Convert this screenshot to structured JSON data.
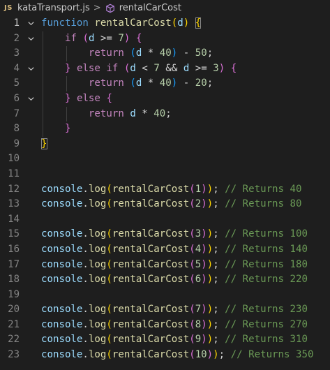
{
  "breadcrumb": {
    "file_badge": "JS",
    "file_name": "kataTransport.js",
    "separator": ">",
    "symbol_icon": "cube-method-icon",
    "symbol_name": "rentalCarCost"
  },
  "colors": {
    "background": "#1e1e1e",
    "keyword": "#569cd6",
    "control": "#c586c0",
    "function": "#dcdcaa",
    "variable": "#9cdcfe",
    "number": "#b5cea8",
    "comment": "#6a9955"
  },
  "editor": {
    "active_line": 1,
    "lines": [
      {
        "num": "1",
        "fold": true,
        "tokens": [
          {
            "t": "function",
            "c": "kw"
          },
          {
            "t": " ",
            "c": ""
          },
          {
            "t": "rentalCarCost",
            "c": "fn"
          },
          {
            "t": "(",
            "c": "br1"
          },
          {
            "t": "d",
            "c": "var"
          },
          {
            "t": ")",
            "c": "br1"
          },
          {
            "t": " ",
            "c": ""
          },
          {
            "t": "{",
            "c": "br1 bm"
          }
        ]
      },
      {
        "num": "2",
        "fold": true,
        "tokens": [
          {
            "t": "    ",
            "c": ""
          },
          {
            "t": "if",
            "c": "ctl"
          },
          {
            "t": " ",
            "c": ""
          },
          {
            "t": "(",
            "c": "br2"
          },
          {
            "t": "d",
            "c": "var"
          },
          {
            "t": " >= ",
            "c": ""
          },
          {
            "t": "7",
            "c": "num"
          },
          {
            "t": ")",
            "c": "br2"
          },
          {
            "t": " ",
            "c": ""
          },
          {
            "t": "{",
            "c": "br2"
          }
        ]
      },
      {
        "num": "3",
        "fold": false,
        "tokens": [
          {
            "t": "        ",
            "c": ""
          },
          {
            "t": "return",
            "c": "ctl"
          },
          {
            "t": " ",
            "c": ""
          },
          {
            "t": "(",
            "c": "br3"
          },
          {
            "t": "d",
            "c": "var"
          },
          {
            "t": " * ",
            "c": ""
          },
          {
            "t": "40",
            "c": "num"
          },
          {
            "t": ")",
            "c": "br3"
          },
          {
            "t": " - ",
            "c": ""
          },
          {
            "t": "50",
            "c": "num"
          },
          {
            "t": ";",
            "c": ""
          }
        ]
      },
      {
        "num": "4",
        "fold": true,
        "tokens": [
          {
            "t": "    ",
            "c": ""
          },
          {
            "t": "}",
            "c": "br2"
          },
          {
            "t": " ",
            "c": ""
          },
          {
            "t": "else",
            "c": "ctl"
          },
          {
            "t": " ",
            "c": ""
          },
          {
            "t": "if",
            "c": "ctl"
          },
          {
            "t": " ",
            "c": ""
          },
          {
            "t": "(",
            "c": "br2"
          },
          {
            "t": "d",
            "c": "var"
          },
          {
            "t": " < ",
            "c": ""
          },
          {
            "t": "7",
            "c": "num"
          },
          {
            "t": " && ",
            "c": ""
          },
          {
            "t": "d",
            "c": "var"
          },
          {
            "t": " >= ",
            "c": ""
          },
          {
            "t": "3",
            "c": "num"
          },
          {
            "t": ")",
            "c": "br2"
          },
          {
            "t": " ",
            "c": ""
          },
          {
            "t": "{",
            "c": "br2"
          }
        ]
      },
      {
        "num": "5",
        "fold": false,
        "tokens": [
          {
            "t": "        ",
            "c": ""
          },
          {
            "t": "return",
            "c": "ctl"
          },
          {
            "t": " ",
            "c": ""
          },
          {
            "t": "(",
            "c": "br3"
          },
          {
            "t": "d",
            "c": "var"
          },
          {
            "t": " * ",
            "c": ""
          },
          {
            "t": "40",
            "c": "num"
          },
          {
            "t": ")",
            "c": "br3"
          },
          {
            "t": " - ",
            "c": ""
          },
          {
            "t": "20",
            "c": "num"
          },
          {
            "t": ";",
            "c": ""
          }
        ]
      },
      {
        "num": "6",
        "fold": true,
        "tokens": [
          {
            "t": "    ",
            "c": ""
          },
          {
            "t": "}",
            "c": "br2"
          },
          {
            "t": " ",
            "c": ""
          },
          {
            "t": "else",
            "c": "ctl"
          },
          {
            "t": " ",
            "c": ""
          },
          {
            "t": "{",
            "c": "br2"
          }
        ]
      },
      {
        "num": "7",
        "fold": false,
        "tokens": [
          {
            "t": "        ",
            "c": ""
          },
          {
            "t": "return",
            "c": "ctl"
          },
          {
            "t": " ",
            "c": ""
          },
          {
            "t": "d",
            "c": "var"
          },
          {
            "t": " * ",
            "c": ""
          },
          {
            "t": "40",
            "c": "num"
          },
          {
            "t": ";",
            "c": ""
          }
        ]
      },
      {
        "num": "8",
        "fold": false,
        "tokens": [
          {
            "t": "    ",
            "c": ""
          },
          {
            "t": "}",
            "c": "br2"
          }
        ]
      },
      {
        "num": "9",
        "fold": false,
        "tokens": [
          {
            "t": "}",
            "c": "br1 bm"
          }
        ]
      },
      {
        "num": "10",
        "fold": false,
        "tokens": []
      },
      {
        "num": "11",
        "fold": false,
        "tokens": []
      },
      {
        "num": "12",
        "fold": false,
        "tokens": [
          {
            "t": "console",
            "c": "obj"
          },
          {
            "t": ".",
            "c": ""
          },
          {
            "t": "log",
            "c": "fn"
          },
          {
            "t": "(",
            "c": "br1"
          },
          {
            "t": "rentalCarCost",
            "c": "fn"
          },
          {
            "t": "(",
            "c": "br2"
          },
          {
            "t": "1",
            "c": "num"
          },
          {
            "t": ")",
            "c": "br2"
          },
          {
            "t": ")",
            "c": "br1"
          },
          {
            "t": "; ",
            "c": ""
          },
          {
            "t": "// Returns 40",
            "c": "cmt"
          }
        ]
      },
      {
        "num": "13",
        "fold": false,
        "tokens": [
          {
            "t": "console",
            "c": "obj"
          },
          {
            "t": ".",
            "c": ""
          },
          {
            "t": "log",
            "c": "fn"
          },
          {
            "t": "(",
            "c": "br1"
          },
          {
            "t": "rentalCarCost",
            "c": "fn"
          },
          {
            "t": "(",
            "c": "br2"
          },
          {
            "t": "2",
            "c": "num"
          },
          {
            "t": ")",
            "c": "br2"
          },
          {
            "t": ")",
            "c": "br1"
          },
          {
            "t": "; ",
            "c": ""
          },
          {
            "t": "// Returns 80",
            "c": "cmt"
          }
        ]
      },
      {
        "num": "14",
        "fold": false,
        "tokens": []
      },
      {
        "num": "15",
        "fold": false,
        "tokens": [
          {
            "t": "console",
            "c": "obj"
          },
          {
            "t": ".",
            "c": ""
          },
          {
            "t": "log",
            "c": "fn"
          },
          {
            "t": "(",
            "c": "br1"
          },
          {
            "t": "rentalCarCost",
            "c": "fn"
          },
          {
            "t": "(",
            "c": "br2"
          },
          {
            "t": "3",
            "c": "num"
          },
          {
            "t": ")",
            "c": "br2"
          },
          {
            "t": ")",
            "c": "br1"
          },
          {
            "t": "; ",
            "c": ""
          },
          {
            "t": "// Returns 100",
            "c": "cmt"
          }
        ]
      },
      {
        "num": "16",
        "fold": false,
        "tokens": [
          {
            "t": "console",
            "c": "obj"
          },
          {
            "t": ".",
            "c": ""
          },
          {
            "t": "log",
            "c": "fn"
          },
          {
            "t": "(",
            "c": "br1"
          },
          {
            "t": "rentalCarCost",
            "c": "fn"
          },
          {
            "t": "(",
            "c": "br2"
          },
          {
            "t": "4",
            "c": "num"
          },
          {
            "t": ")",
            "c": "br2"
          },
          {
            "t": ")",
            "c": "br1"
          },
          {
            "t": "; ",
            "c": ""
          },
          {
            "t": "// Returns 140",
            "c": "cmt"
          }
        ]
      },
      {
        "num": "17",
        "fold": false,
        "tokens": [
          {
            "t": "console",
            "c": "obj"
          },
          {
            "t": ".",
            "c": ""
          },
          {
            "t": "log",
            "c": "fn"
          },
          {
            "t": "(",
            "c": "br1"
          },
          {
            "t": "rentalCarCost",
            "c": "fn"
          },
          {
            "t": "(",
            "c": "br2"
          },
          {
            "t": "5",
            "c": "num"
          },
          {
            "t": ")",
            "c": "br2"
          },
          {
            "t": ")",
            "c": "br1"
          },
          {
            "t": "; ",
            "c": ""
          },
          {
            "t": "// Returns 180",
            "c": "cmt"
          }
        ]
      },
      {
        "num": "18",
        "fold": false,
        "tokens": [
          {
            "t": "console",
            "c": "obj"
          },
          {
            "t": ".",
            "c": ""
          },
          {
            "t": "log",
            "c": "fn"
          },
          {
            "t": "(",
            "c": "br1"
          },
          {
            "t": "rentalCarCost",
            "c": "fn"
          },
          {
            "t": "(",
            "c": "br2"
          },
          {
            "t": "6",
            "c": "num"
          },
          {
            "t": ")",
            "c": "br2"
          },
          {
            "t": ")",
            "c": "br1"
          },
          {
            "t": "; ",
            "c": ""
          },
          {
            "t": "// Returns 220",
            "c": "cmt"
          }
        ]
      },
      {
        "num": "19",
        "fold": false,
        "tokens": []
      },
      {
        "num": "20",
        "fold": false,
        "tokens": [
          {
            "t": "console",
            "c": "obj"
          },
          {
            "t": ".",
            "c": ""
          },
          {
            "t": "log",
            "c": "fn"
          },
          {
            "t": "(",
            "c": "br1"
          },
          {
            "t": "rentalCarCost",
            "c": "fn"
          },
          {
            "t": "(",
            "c": "br2"
          },
          {
            "t": "7",
            "c": "num"
          },
          {
            "t": ")",
            "c": "br2"
          },
          {
            "t": ")",
            "c": "br1"
          },
          {
            "t": "; ",
            "c": ""
          },
          {
            "t": "// Returns 230",
            "c": "cmt"
          }
        ]
      },
      {
        "num": "21",
        "fold": false,
        "tokens": [
          {
            "t": "console",
            "c": "obj"
          },
          {
            "t": ".",
            "c": ""
          },
          {
            "t": "log",
            "c": "fn"
          },
          {
            "t": "(",
            "c": "br1"
          },
          {
            "t": "rentalCarCost",
            "c": "fn"
          },
          {
            "t": "(",
            "c": "br2"
          },
          {
            "t": "8",
            "c": "num"
          },
          {
            "t": ")",
            "c": "br2"
          },
          {
            "t": ")",
            "c": "br1"
          },
          {
            "t": "; ",
            "c": ""
          },
          {
            "t": "// Returns 270",
            "c": "cmt"
          }
        ]
      },
      {
        "num": "22",
        "fold": false,
        "tokens": [
          {
            "t": "console",
            "c": "obj"
          },
          {
            "t": ".",
            "c": ""
          },
          {
            "t": "log",
            "c": "fn"
          },
          {
            "t": "(",
            "c": "br1"
          },
          {
            "t": "rentalCarCost",
            "c": "fn"
          },
          {
            "t": "(",
            "c": "br2"
          },
          {
            "t": "9",
            "c": "num"
          },
          {
            "t": ")",
            "c": "br2"
          },
          {
            "t": ")",
            "c": "br1"
          },
          {
            "t": "; ",
            "c": ""
          },
          {
            "t": "// Returns 310",
            "c": "cmt"
          }
        ]
      },
      {
        "num": "23",
        "fold": false,
        "tokens": [
          {
            "t": "console",
            "c": "obj"
          },
          {
            "t": ".",
            "c": ""
          },
          {
            "t": "log",
            "c": "fn"
          },
          {
            "t": "(",
            "c": "br1"
          },
          {
            "t": "rentalCarCost",
            "c": "fn"
          },
          {
            "t": "(",
            "c": "br2"
          },
          {
            "t": "10",
            "c": "num"
          },
          {
            "t": ")",
            "c": "br2"
          },
          {
            "t": ")",
            "c": "br1"
          },
          {
            "t": "; ",
            "c": ""
          },
          {
            "t": "// Returns 350",
            "c": "cmt"
          }
        ]
      }
    ]
  }
}
